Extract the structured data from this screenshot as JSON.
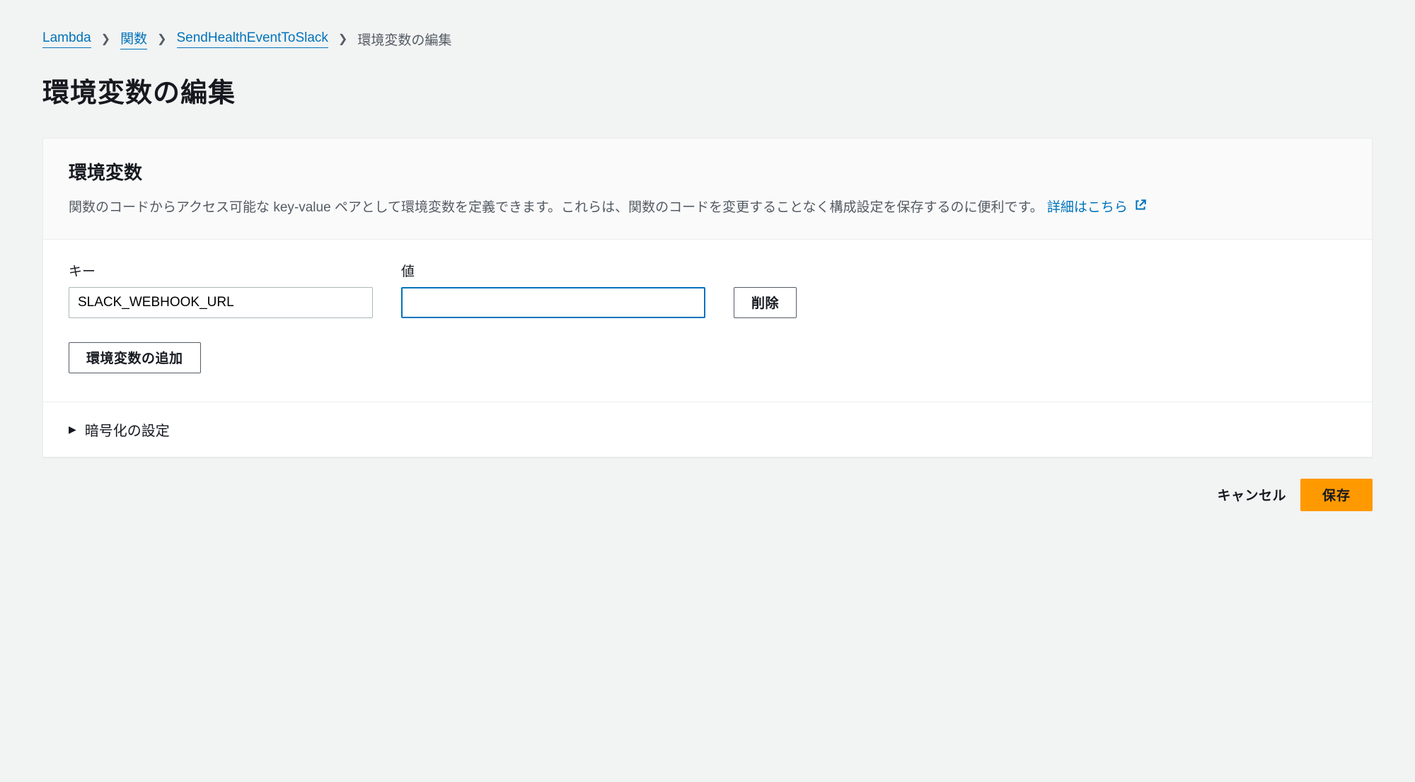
{
  "breadcrumb": {
    "items": [
      {
        "label": "Lambda"
      },
      {
        "label": "関数"
      },
      {
        "label": "SendHealthEventToSlack"
      }
    ],
    "current": "環境変数の編集"
  },
  "page_title": "環境変数の編集",
  "panel": {
    "title": "環境変数",
    "description": "関数のコードからアクセス可能な key-value ペアとして環境変数を定義できます。これらは、関数のコードを変更することなく構成設定を保存するのに便利です。",
    "learn_more": "詳細はこちら"
  },
  "form": {
    "key_label": "キー",
    "value_label": "値",
    "rows": [
      {
        "key": "SLACK_WEBHOOK_URL",
        "value": ""
      }
    ],
    "delete_button": "削除",
    "add_button": "環境変数の追加"
  },
  "encryption": {
    "title": "暗号化の設定"
  },
  "actions": {
    "cancel": "キャンセル",
    "save": "保存"
  }
}
